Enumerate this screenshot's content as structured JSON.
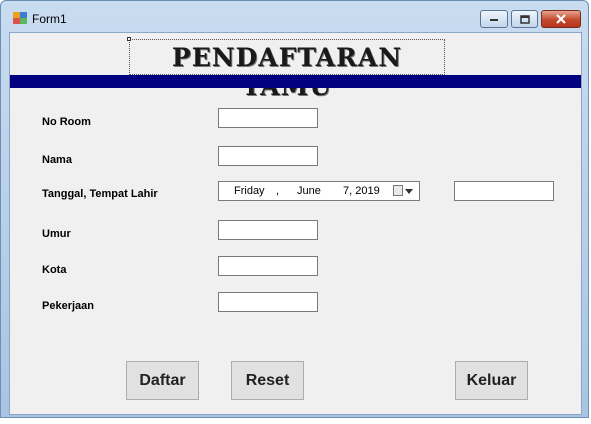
{
  "window": {
    "title": "Form1"
  },
  "header": {
    "title": "PENDAFTARAN TAMU"
  },
  "form": {
    "fields": [
      {
        "label": "No Room",
        "value": ""
      },
      {
        "label": "Nama",
        "value": ""
      },
      {
        "label": "Tanggal, Tempat Lahir",
        "value": ""
      },
      {
        "label": "Umur",
        "value": ""
      },
      {
        "label": "Kota",
        "value": ""
      },
      {
        "label": "Pekerjaan",
        "value": ""
      }
    ],
    "birth_date": {
      "day": "Friday",
      "sep": ",",
      "month": "June",
      "date": "7, 2019"
    }
  },
  "buttons": {
    "daftar": "Daftar",
    "reset": "Reset",
    "keluar": "Keluar"
  },
  "colors": {
    "banner": "#000080",
    "client_bg": "#f0f0f0"
  },
  "icons": {
    "app": "app-icon",
    "minimize": "minimize-icon",
    "maximize": "maximize-icon",
    "close": "close-icon",
    "calendar": "calendar-icon"
  }
}
